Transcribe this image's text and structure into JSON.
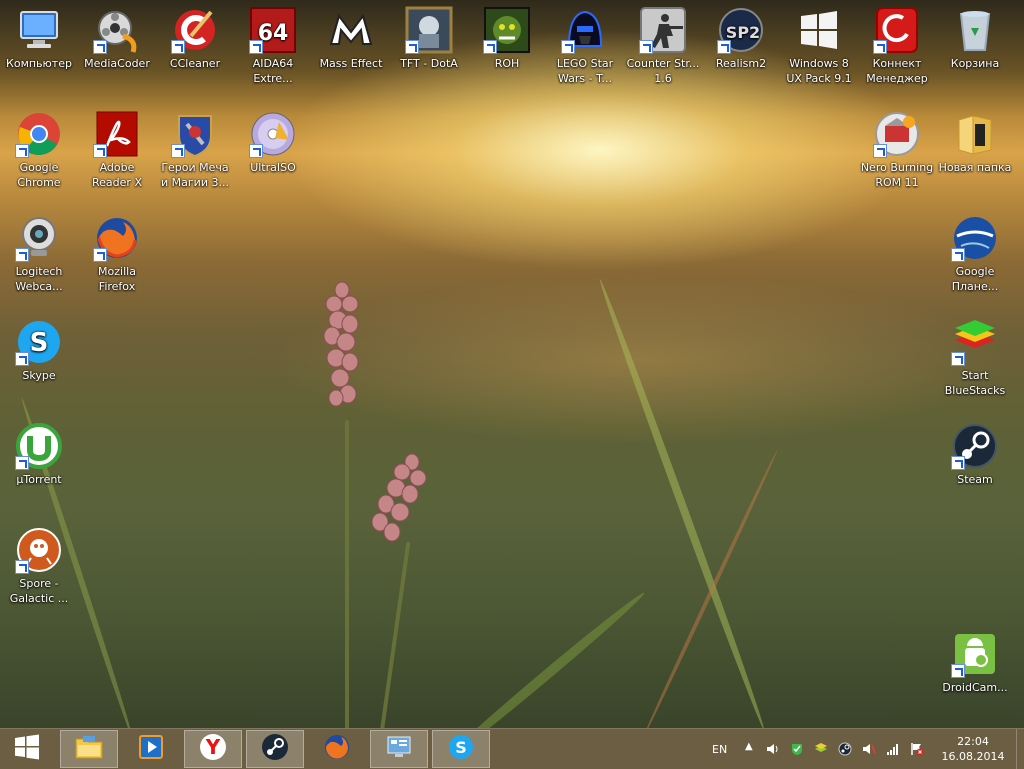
{
  "desktop": {
    "icons": [
      {
        "label": "Компьютер",
        "icon": "computer-icon"
      },
      {
        "label": "MediaCoder",
        "icon": "mediacoder-icon"
      },
      {
        "label": "CCleaner",
        "icon": "ccleaner-icon"
      },
      {
        "label": "AIDA64 Extre...",
        "icon": "aida64-icon"
      },
      {
        "label": "Mass Effect",
        "icon": "mass-effect-icon"
      },
      {
        "label": "TFT - DotA",
        "icon": "tft-dota-icon"
      },
      {
        "label": "ROH",
        "icon": "roh-icon"
      },
      {
        "label": "LEGO Star Wars - T...",
        "icon": "lego-star-wars-icon"
      },
      {
        "label": "Counter Str... 1.6",
        "icon": "counter-strike-icon"
      },
      {
        "label": "Realism2",
        "icon": "realism2-icon"
      },
      {
        "label": "Windows 8 UX Pack 9.1",
        "icon": "windows8-uxpack-icon"
      },
      {
        "label": "Коннект Менеджер",
        "icon": "connect-manager-icon"
      },
      {
        "label": "Корзина",
        "icon": "recycle-bin-icon"
      },
      {
        "label": "Google Chrome",
        "icon": "chrome-icon"
      },
      {
        "label": "Adobe Reader X",
        "icon": "adobe-reader-icon"
      },
      {
        "label": "Герои Меча и Магии 3...",
        "icon": "heroes3-icon"
      },
      {
        "label": "UltraISO",
        "icon": "ultraiso-icon"
      },
      {
        "label": "Nero Burning ROM 11",
        "icon": "nero-icon"
      },
      {
        "label": "Новая папка",
        "icon": "folder-icon"
      },
      {
        "label": "Logitech Webca...",
        "icon": "logitech-webcam-icon"
      },
      {
        "label": "Mozilla Firefox",
        "icon": "firefox-icon"
      },
      {
        "label": "Google Плане...",
        "icon": "google-earth-icon"
      },
      {
        "label": "Skype",
        "icon": "skype-icon"
      },
      {
        "label": "Start BlueStacks",
        "icon": "bluestacks-icon"
      },
      {
        "label": "µTorrent",
        "icon": "utorrent-icon"
      },
      {
        "label": "Steam",
        "icon": "steam-icon"
      },
      {
        "label": "Spore - Galactic ...",
        "icon": "spore-icon"
      },
      {
        "label": "DroidCam...",
        "icon": "droidcam-icon"
      }
    ]
  },
  "taskbar": {
    "start_icon": "windows-start-icon",
    "apps": [
      {
        "icon": "file-explorer-icon",
        "active": true
      },
      {
        "icon": "media-player-icon",
        "active": false
      },
      {
        "icon": "yandex-browser-icon",
        "active": true
      },
      {
        "icon": "steam-icon",
        "active": true
      },
      {
        "icon": "firefox-icon",
        "active": false
      },
      {
        "icon": "control-panel-icon",
        "active": true
      },
      {
        "icon": "skype-icon",
        "active": true
      }
    ],
    "tray": {
      "language": "EN",
      "time": "22:04",
      "date": "16.08.2014"
    }
  },
  "colors": {
    "taskbar": "#5f5032",
    "accent": "#1d5dd6"
  }
}
